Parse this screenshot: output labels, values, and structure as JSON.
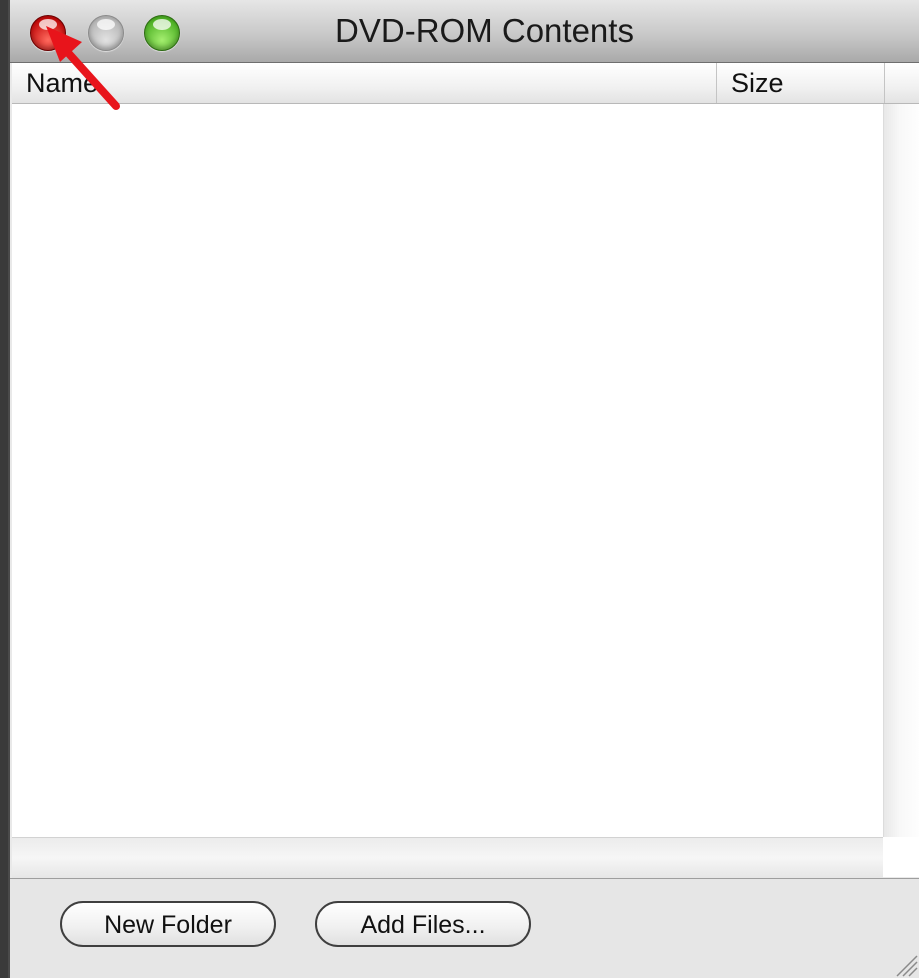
{
  "window": {
    "title": "DVD-ROM Contents"
  },
  "traffic_lights": [
    "close",
    "minimize",
    "zoom"
  ],
  "list": {
    "columns": [
      "Name",
      "Size"
    ],
    "rows": []
  },
  "buttons": {
    "new_folder": "New Folder",
    "add_files": "Add Files..."
  },
  "colors": {
    "close_button": "#d1201c",
    "zoom_button": "#4fb226",
    "annotation_arrow": "#e8141b"
  },
  "annotation": {
    "type": "arrow",
    "points_to": "close-button"
  }
}
